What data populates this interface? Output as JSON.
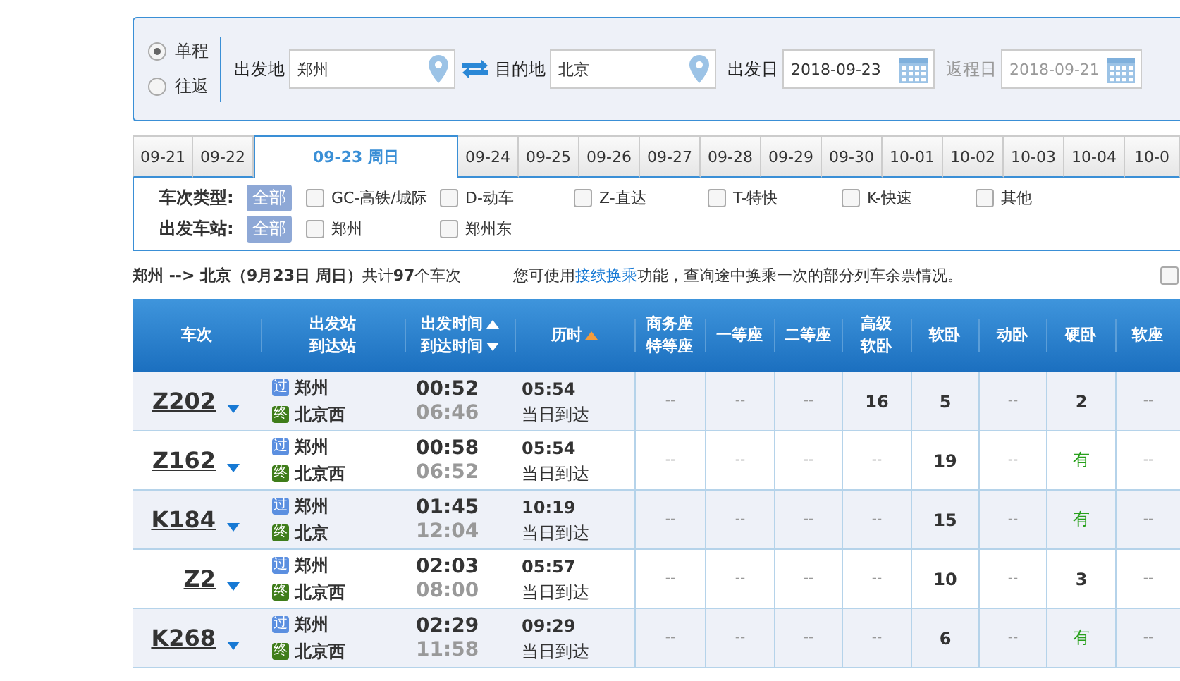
{
  "search": {
    "trip_types": [
      {
        "label": "单程",
        "selected": true
      },
      {
        "label": "往返",
        "selected": false
      }
    ],
    "from": {
      "label": "出发地",
      "value": "郑州"
    },
    "to": {
      "label": "目的地",
      "value": "北京"
    },
    "depart_date": {
      "label": "出发日",
      "value": "2018-09-23",
      "disabled": false
    },
    "return_date": {
      "label": "返程日",
      "value": "2018-09-21",
      "disabled": true
    }
  },
  "date_tabs": [
    {
      "label": "09-21",
      "selected": false
    },
    {
      "label": "09-22",
      "selected": false
    },
    {
      "label": "09-23 周日",
      "selected": true
    },
    {
      "label": "09-24",
      "selected": false
    },
    {
      "label": "09-25",
      "selected": false
    },
    {
      "label": "09-26",
      "selected": false
    },
    {
      "label": "09-27",
      "selected": false
    },
    {
      "label": "09-28",
      "selected": false
    },
    {
      "label": "09-29",
      "selected": false
    },
    {
      "label": "09-30",
      "selected": false
    },
    {
      "label": "10-01",
      "selected": false
    },
    {
      "label": "10-02",
      "selected": false
    },
    {
      "label": "10-03",
      "selected": false
    },
    {
      "label": "10-04",
      "selected": false
    },
    {
      "label": "10-0",
      "selected": false
    }
  ],
  "filters": [
    {
      "label": "车次类型:",
      "all": {
        "label": "全部",
        "selected": true
      },
      "options": [
        {
          "label": "GC-高铁/城际",
          "checked": false
        },
        {
          "label": "D-动车",
          "checked": false
        },
        {
          "label": "Z-直达",
          "checked": false
        },
        {
          "label": "T-特快",
          "checked": false
        },
        {
          "label": "K-快速",
          "checked": false
        },
        {
          "label": "其他",
          "checked": false
        }
      ]
    },
    {
      "label": "出发车站:",
      "all": {
        "label": "全部",
        "selected": true
      },
      "options": [
        {
          "label": "郑州",
          "checked": false
        },
        {
          "label": "郑州东",
          "checked": false
        }
      ]
    }
  ],
  "summary": {
    "text": "**郑州 --> 北京（9月23日  周日）**共计**97**个车次",
    "tip_before": "您可使用",
    "tip_link": "接续换乘",
    "tip_after": "功能，查询途中换乘一次的部分列车余票情况。",
    "checkbox_checked": false
  },
  "table": {
    "columns": [
      {
        "lines": [
          "车次"
        ],
        "sortable": false,
        "sorted": false
      },
      {
        "lines": [
          "出发站",
          "到达站"
        ],
        "sortable": false,
        "sorted": false
      },
      {
        "lines": [
          "出发时间",
          "到达时间"
        ],
        "sortable": true,
        "sorted": false
      },
      {
        "lines": [
          "历时"
        ],
        "sortable": false,
        "sorted": true
      },
      {
        "lines": [
          "商务座",
          "特等座"
        ],
        "sortable": false,
        "sorted": false
      },
      {
        "lines": [
          "一等座"
        ],
        "sortable": false,
        "sorted": false
      },
      {
        "lines": [
          "二等座"
        ],
        "sortable": false,
        "sorted": false
      },
      {
        "lines": [
          "高级",
          "软卧"
        ],
        "sortable": false,
        "sorted": false
      },
      {
        "lines": [
          "软卧"
        ],
        "sortable": false,
        "sorted": false
      },
      {
        "lines": [
          "动卧"
        ],
        "sortable": false,
        "sorted": false
      },
      {
        "lines": [
          "硬卧"
        ],
        "sortable": false,
        "sorted": false
      },
      {
        "lines": [
          "软座"
        ],
        "sortable": false,
        "sorted": false
      }
    ],
    "rows": [
      {
        "train": "Z202",
        "from_tag": "过",
        "from": "郑州",
        "to_tag": "终",
        "to": "北京西",
        "depart": "00:52",
        "arrive": "06:46",
        "duration": "05:54",
        "arrival_day": "当日到达",
        "seats": [
          {
            "text": "--",
            "kind": "none"
          },
          {
            "text": "--",
            "kind": "none"
          },
          {
            "text": "--",
            "kind": "none"
          },
          {
            "text": "16",
            "kind": "count"
          },
          {
            "text": "5",
            "kind": "count"
          },
          {
            "text": "--",
            "kind": "none"
          },
          {
            "text": "2",
            "kind": "count"
          },
          {
            "text": "--",
            "kind": "none"
          }
        ]
      },
      {
        "train": "Z162",
        "from_tag": "过",
        "from": "郑州",
        "to_tag": "终",
        "to": "北京西",
        "depart": "00:58",
        "arrive": "06:52",
        "duration": "05:54",
        "arrival_day": "当日到达",
        "seats": [
          {
            "text": "--",
            "kind": "none"
          },
          {
            "text": "--",
            "kind": "none"
          },
          {
            "text": "--",
            "kind": "none"
          },
          {
            "text": "--",
            "kind": "none"
          },
          {
            "text": "19",
            "kind": "count"
          },
          {
            "text": "--",
            "kind": "none"
          },
          {
            "text": "有",
            "kind": "plenty"
          },
          {
            "text": "--",
            "kind": "none"
          }
        ]
      },
      {
        "train": "K184",
        "from_tag": "过",
        "from": "郑州",
        "to_tag": "终",
        "to": "北京",
        "depart": "01:45",
        "arrive": "12:04",
        "duration": "10:19",
        "arrival_day": "当日到达",
        "seats": [
          {
            "text": "--",
            "kind": "none"
          },
          {
            "text": "--",
            "kind": "none"
          },
          {
            "text": "--",
            "kind": "none"
          },
          {
            "text": "--",
            "kind": "none"
          },
          {
            "text": "15",
            "kind": "count"
          },
          {
            "text": "--",
            "kind": "none"
          },
          {
            "text": "有",
            "kind": "plenty"
          },
          {
            "text": "--",
            "kind": "none"
          }
        ]
      },
      {
        "train": "Z2",
        "from_tag": "过",
        "from": "郑州",
        "to_tag": "终",
        "to": "北京西",
        "depart": "02:03",
        "arrive": "08:00",
        "duration": "05:57",
        "arrival_day": "当日到达",
        "seats": [
          {
            "text": "--",
            "kind": "none"
          },
          {
            "text": "--",
            "kind": "none"
          },
          {
            "text": "--",
            "kind": "none"
          },
          {
            "text": "--",
            "kind": "none"
          },
          {
            "text": "10",
            "kind": "count"
          },
          {
            "text": "--",
            "kind": "none"
          },
          {
            "text": "3",
            "kind": "count"
          },
          {
            "text": "--",
            "kind": "none"
          }
        ]
      },
      {
        "train": "K268",
        "from_tag": "过",
        "from": "郑州",
        "to_tag": "终",
        "to": "北京西",
        "depart": "02:29",
        "arrive": "11:58",
        "duration": "09:29",
        "arrival_day": "当日到达",
        "seats": [
          {
            "text": "--",
            "kind": "none"
          },
          {
            "text": "--",
            "kind": "none"
          },
          {
            "text": "--",
            "kind": "none"
          },
          {
            "text": "--",
            "kind": "none"
          },
          {
            "text": "6",
            "kind": "count"
          },
          {
            "text": "--",
            "kind": "none"
          },
          {
            "text": "有",
            "kind": "plenty"
          },
          {
            "text": "--",
            "kind": "none"
          }
        ]
      }
    ]
  }
}
